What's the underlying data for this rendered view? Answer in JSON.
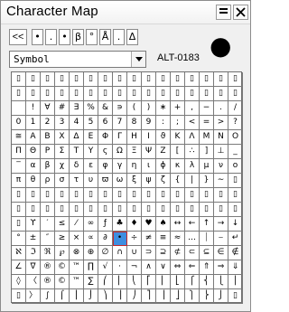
{
  "window": {
    "title": "Character Map"
  },
  "toolbar": {
    "back_label": "<<",
    "recent": [
      "•",
      ".",
      "•",
      "β",
      "°",
      "Å",
      ".",
      "Δ"
    ],
    "current_char": "●"
  },
  "font": {
    "name": "Symbol"
  },
  "alt_code": "ALT-0183",
  "selected_index": 183,
  "grid": [
    [
      "▯",
      "▯",
      "▯",
      "▯",
      "▯",
      "▯",
      "▯",
      "▯",
      "▯",
      "▯",
      "▯",
      "▯",
      "▯",
      "▯",
      "▯",
      "▯"
    ],
    [
      "▯",
      "▯",
      "▯",
      "▯",
      "▯",
      "▯",
      "▯",
      "▯",
      "▯",
      "▯",
      "▯",
      "▯",
      "▯",
      "▯",
      "▯",
      "▯"
    ],
    [
      "",
      "!",
      "∀",
      "#",
      "∃",
      "%",
      "&",
      "∍",
      "(",
      ")",
      "∗",
      "+",
      ",",
      "−",
      ".",
      "/"
    ],
    [
      "0",
      "1",
      "2",
      "3",
      "4",
      "5",
      "6",
      "7",
      "8",
      "9",
      ":",
      ";",
      "<",
      "=",
      ">",
      "?"
    ],
    [
      "≅",
      "Α",
      "Β",
      "Χ",
      "Δ",
      "Ε",
      "Φ",
      "Γ",
      "Η",
      "Ι",
      "ϑ",
      "Κ",
      "Λ",
      "Μ",
      "Ν",
      "Ο"
    ],
    [
      "Π",
      "Θ",
      "Ρ",
      "Σ",
      "Τ",
      "Υ",
      "ς",
      "Ω",
      "Ξ",
      "Ψ",
      "Ζ",
      "[",
      "∴",
      "]",
      "⊥",
      "_"
    ],
    [
      "‾",
      "α",
      "β",
      "χ",
      "δ",
      "ε",
      "φ",
      "γ",
      "η",
      "ι",
      "ϕ",
      "κ",
      "λ",
      "μ",
      "ν",
      "ο"
    ],
    [
      "π",
      "θ",
      "ρ",
      "σ",
      "τ",
      "υ",
      "ϖ",
      "ω",
      "ξ",
      "ψ",
      "ζ",
      "{",
      "|",
      "}",
      "∼",
      "▯"
    ],
    [
      "▯",
      "▯",
      "▯",
      "▯",
      "▯",
      "▯",
      "▯",
      "▯",
      "▯",
      "▯",
      "▯",
      "▯",
      "▯",
      "▯",
      "▯",
      "▯"
    ],
    [
      "▯",
      "▯",
      "▯",
      "▯",
      "▯",
      "▯",
      "▯",
      "▯",
      "▯",
      "▯",
      "▯",
      "▯",
      "▯",
      "▯",
      "▯",
      "▯"
    ],
    [
      "▯",
      "ϒ",
      "′",
      "≤",
      "⁄",
      "∞",
      "ƒ",
      "♣",
      "♦",
      "♥",
      "♠",
      "↔",
      "←",
      "↑",
      "→",
      "↓"
    ],
    [
      "°",
      "±",
      "″",
      "≥",
      "×",
      "∝",
      "∂",
      "•",
      "÷",
      "≠",
      "≡",
      "≈",
      "…",
      "⏐",
      "⎯",
      "↵"
    ],
    [
      "ℵ",
      "ℑ",
      "ℜ",
      "℘",
      "⊗",
      "⊕",
      "∅",
      "∩",
      "∪",
      "⊃",
      "⊇",
      "⊄",
      "⊂",
      "⊆",
      "∈",
      "∉"
    ],
    [
      "∠",
      "∇",
      "®",
      "©",
      "™",
      "∏",
      "√",
      "⋅",
      "¬",
      "∧",
      "∨",
      "⇔",
      "⇐",
      "⇑",
      "⇒",
      "⇓"
    ],
    [
      "◊",
      "〈",
      "®",
      "©",
      "™",
      "∑",
      "⎛",
      "⎜",
      "⎝",
      "⎡",
      "⎢",
      "⎣",
      "⎧",
      "⎨",
      "⎩",
      "⎪"
    ],
    [
      "▯",
      "〉",
      "∫",
      "⌠",
      "⎮",
      "⌡",
      "⎞",
      "⎟",
      "⎠",
      "⎤",
      "⎥",
      "⎦",
      "⎫",
      "⎬",
      "⎭",
      "▯"
    ]
  ]
}
